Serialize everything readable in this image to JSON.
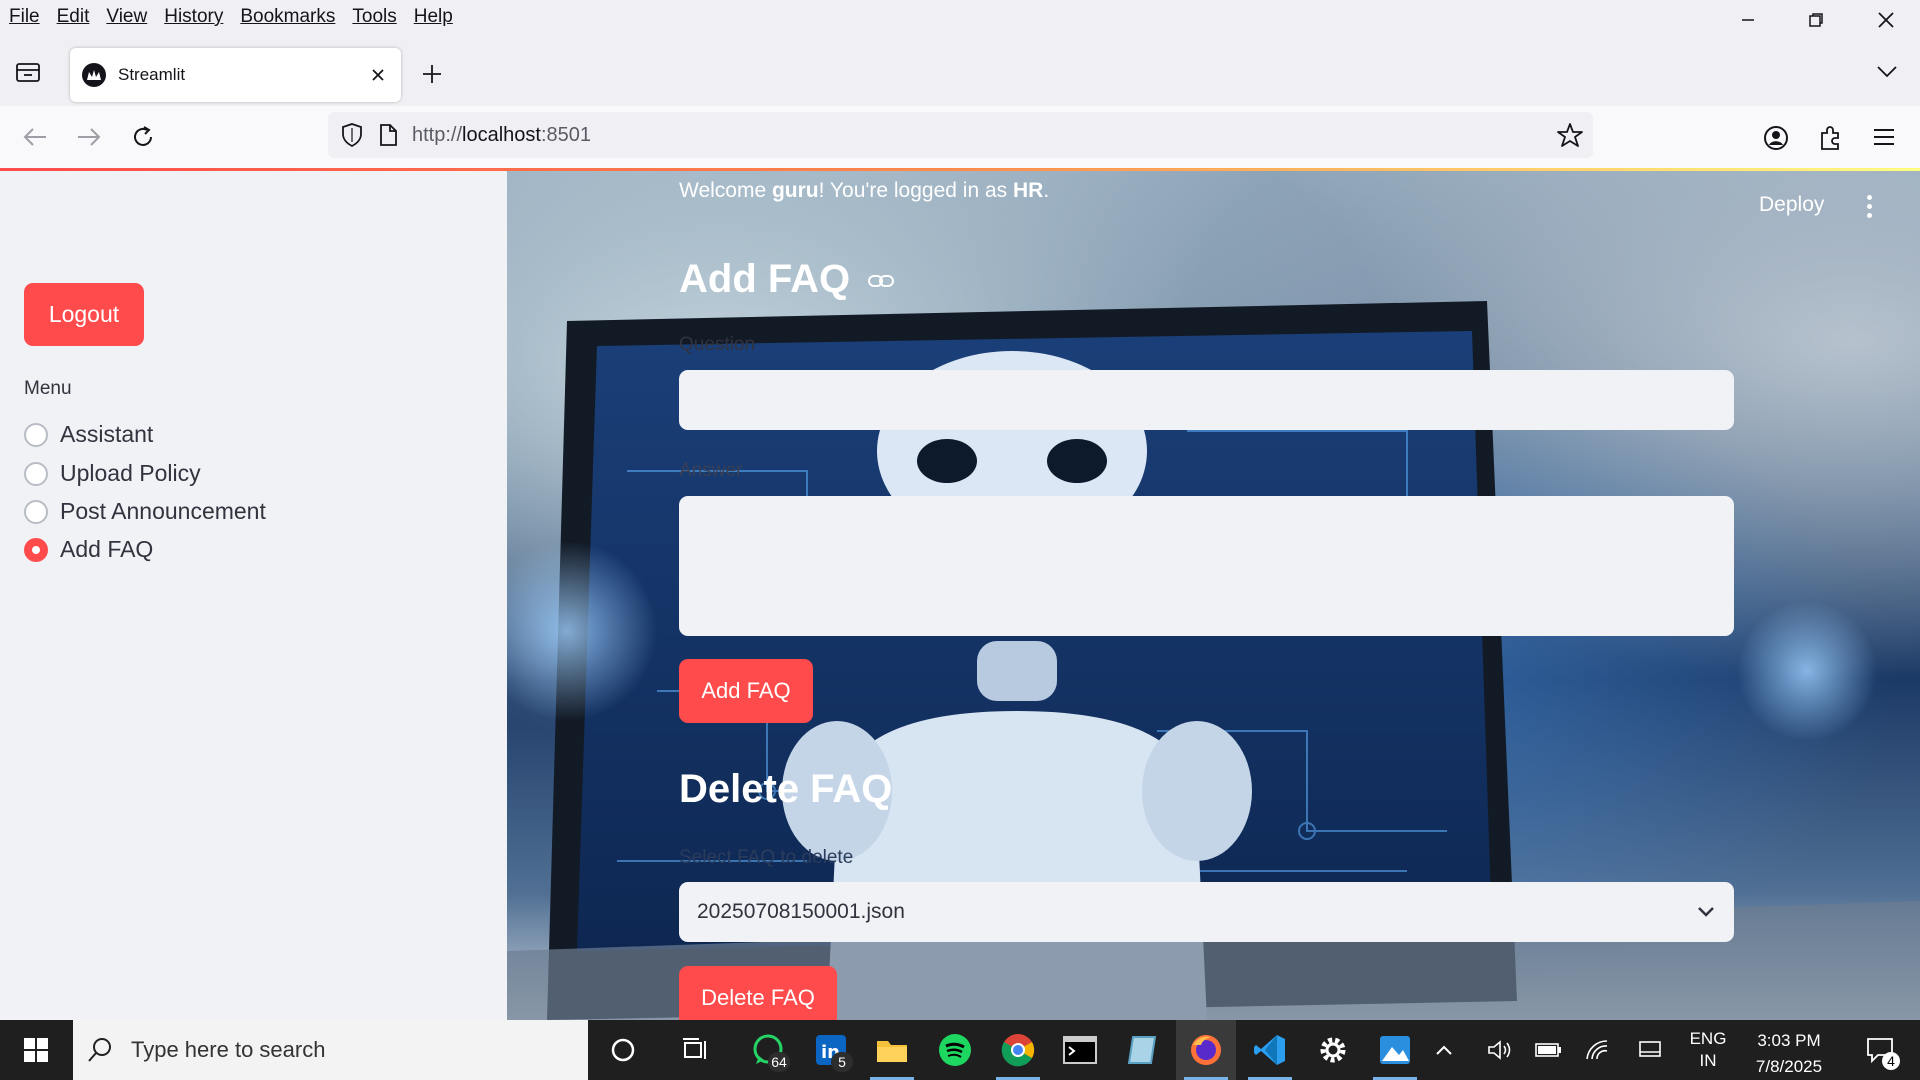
{
  "menubar": {
    "items": [
      "File",
      "Edit",
      "View",
      "History",
      "Bookmarks",
      "Tools",
      "Help"
    ]
  },
  "browser": {
    "tab_title": "Streamlit",
    "url_prefix": "http://",
    "url_host": "localhost",
    "url_port": ":8501"
  },
  "sidebar": {
    "logout_label": "Logout",
    "menu_label": "Menu",
    "options": [
      {
        "label": "Assistant",
        "selected": false
      },
      {
        "label": "Upload Policy",
        "selected": false
      },
      {
        "label": "Post Announcement",
        "selected": false
      },
      {
        "label": "Add FAQ",
        "selected": true
      }
    ]
  },
  "header": {
    "welcome_prefix": "Welcome ",
    "username": "guru",
    "welcome_middle": "! You're logged in as ",
    "role": "HR",
    "welcome_suffix": ".",
    "deploy_label": "Deploy"
  },
  "add_faq": {
    "title": "Add FAQ",
    "question_label": "Question",
    "question_value": "",
    "answer_label": "Answer",
    "answer_value": "",
    "submit_label": "Add FAQ"
  },
  "delete_faq": {
    "title": "Delete FAQ",
    "select_label": "Select FAQ to delete",
    "selected_value": "20250708150001.json",
    "submit_label": "Delete FAQ"
  },
  "taskbar": {
    "search_placeholder": "Type here to search",
    "whatsapp_badge": "64",
    "linkedin_badge": "5",
    "language_line1": "ENG",
    "language_line2": "IN",
    "time": "3:03 PM",
    "date": "7/8/2025",
    "notifications_badge": "4"
  }
}
